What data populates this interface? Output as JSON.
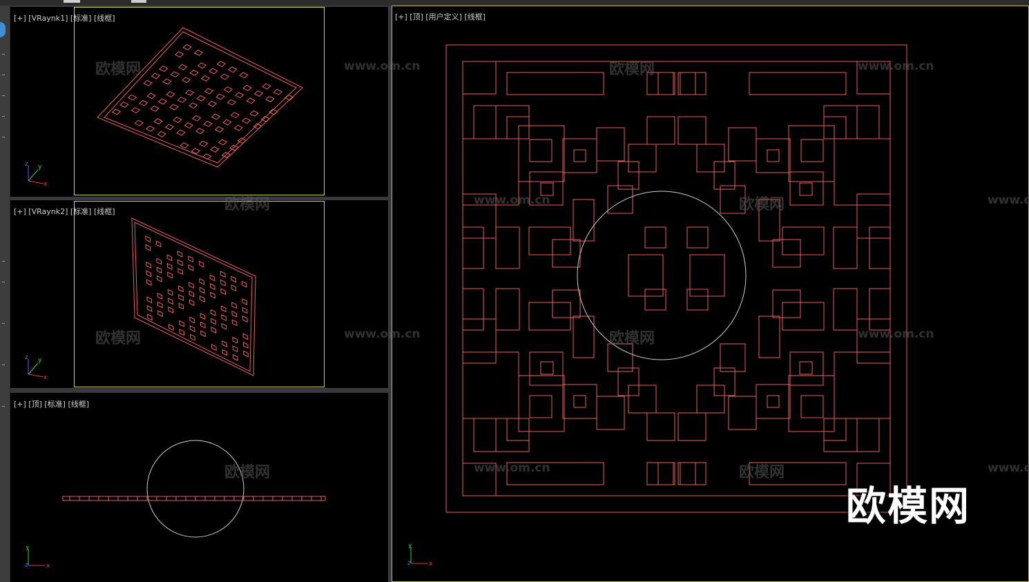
{
  "viewports": [
    {
      "id": "vp1",
      "label": "[+] [VRaynk1] [标准] [线框]"
    },
    {
      "id": "vp2",
      "label": "[+] [VRaynk2] [标准] [线框]"
    },
    {
      "id": "vp3",
      "label": "[+] [顶] [标准] [线框]"
    },
    {
      "id": "vp4",
      "label": "[+] [顶] [用户定义] [线框]"
    }
  ],
  "axis_labels": {
    "x": "x",
    "y": "y",
    "z": "z"
  },
  "watermark": {
    "text": "欧模网",
    "url": "www.om.cn"
  },
  "brand_logo": "欧模网",
  "colors": {
    "wire": "#e8625c",
    "circle": "#d0d0d0",
    "safe_frame": "#d9d35a",
    "active_border": "#c8b44a"
  }
}
